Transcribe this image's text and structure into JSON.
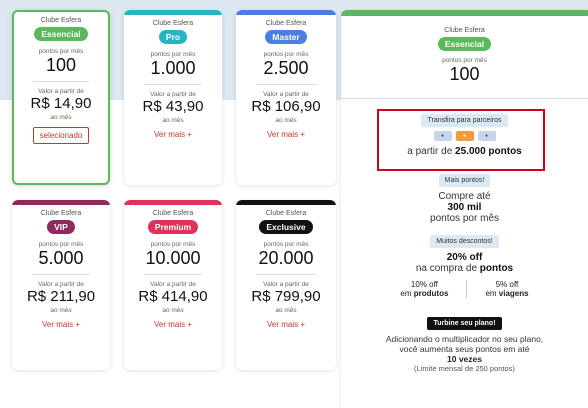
{
  "plans": [
    {
      "brand": "Clube Esfera",
      "name": "Essencial",
      "color": "#5cb85c",
      "points_label": "pontos por mês",
      "points": "100",
      "price_label": "Valor a partir de",
      "price": "R$ 14,90",
      "period": "ao mês",
      "action": "selecionado"
    },
    {
      "brand": "Clube Esfera",
      "name": "Pro",
      "color": "#26b5c4",
      "points_label": "pontos por mês",
      "points": "1.000",
      "price_label": "Valor a partir de",
      "price": "R$ 43,90",
      "period": "ao mês",
      "action": "Ver mais +"
    },
    {
      "brand": "Clube Esfera",
      "name": "Master",
      "color": "#4a7fe0",
      "points_label": "pontos por mês",
      "points": "2.500",
      "price_label": "Valor a partir de",
      "price": "R$ 106,90",
      "period": "ao mês",
      "action": "Ver mais +"
    },
    {
      "brand": "Clube Esfera",
      "name": "VIP",
      "color": "#8e2a5c",
      "points_label": "pontos por mês",
      "points": "5.000",
      "price_label": "Valor a partir de",
      "price": "R$ 211,90",
      "period": "ao mês",
      "action": "Ver mais +"
    },
    {
      "brand": "Clube Esfera",
      "name": "Premium",
      "color": "#e0325a",
      "points_label": "pontos por mês",
      "points": "10.000",
      "price_label": "Valor a partir de",
      "price": "R$ 414,90",
      "period": "ao mês",
      "action": "Ver mais +"
    },
    {
      "brand": "Clube Esfera",
      "name": "Exclusive",
      "color": "#111111",
      "points_label": "pontos por mês",
      "points": "20.000",
      "price_label": "Valor a partir de",
      "price": "R$ 799,90",
      "period": "ao mês",
      "action": "Ver mais +"
    }
  ],
  "panel": {
    "brand": "Clube Esfera",
    "name": "Essencial",
    "points_label": "pontos por mês",
    "points": "100",
    "transfer_chip": "Transfira para parceiros",
    "transfer_prefix": "a partir de",
    "transfer_value": "25.000 pontos",
    "more_points_chip": "Mais pontos!",
    "grow_line1": "Compre até",
    "grow_value": "300 mil",
    "grow_line2": "pontos por mês",
    "discounts_chip": "Muitos descontos!",
    "discount_value": "20% off",
    "discount_prefix": "na compra de",
    "discount_bold": "pontos",
    "products_value": "10% off",
    "products_prefix": "em",
    "products_bold": "produtos",
    "travel_value": "5% off",
    "travel_prefix": "em",
    "travel_bold": "viagens",
    "boost_chip": "Turbine seu plano!",
    "boost_line1": "Adicionando o multiplicador no seu plano,",
    "boost_line2": "você aumenta seus pontos em até",
    "boost_value": "10 vezes",
    "boost_note": "(Limite mensal de 250 pontos)"
  },
  "colors": {
    "accent_green": "#5cb85c",
    "action_red": "#c0392b",
    "highlight_red": "#d0021b"
  }
}
